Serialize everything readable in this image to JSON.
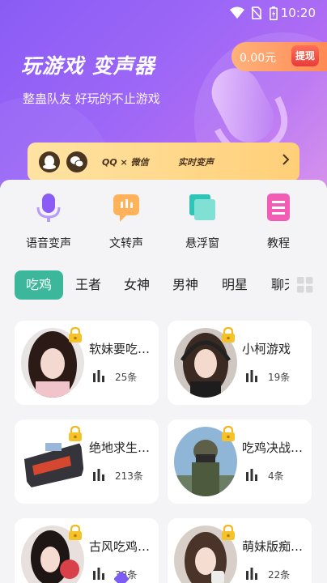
{
  "status_bar": {
    "time": "10:20"
  },
  "hero": {
    "title": "玩游戏  变声器",
    "subtitle": "整蛊队友 好玩的不止游戏",
    "balance": "0.00元",
    "withdraw_label": "提现"
  },
  "banner": {
    "left_text": "QQ × 微信",
    "right_text": "实时变声"
  },
  "menu": [
    {
      "label": "语音变声",
      "icon": "microphone-icon",
      "color": "#8b5cf6"
    },
    {
      "label": "文转声",
      "icon": "chat-bubble-icon",
      "color": "#ff9d3d"
    },
    {
      "label": "悬浮窗",
      "icon": "window-stack-icon",
      "color": "#2ec4b6"
    },
    {
      "label": "教程",
      "icon": "document-icon",
      "color": "#f25cb5"
    }
  ],
  "tabs": [
    "吃鸡",
    "王者",
    "女神",
    "男神",
    "明星",
    "聊天"
  ],
  "active_tab": "吃鸡",
  "cards": [
    {
      "name": "软妹要吃…",
      "count": "25条"
    },
    {
      "name": "小柯游戏",
      "count": "19条"
    },
    {
      "name": "绝地求生…",
      "count": "213条"
    },
    {
      "name": "吃鸡决战…",
      "count": "4条"
    },
    {
      "name": "古风吃鸡…",
      "count": "38条"
    },
    {
      "name": "萌妹版痴…",
      "count": "22条"
    }
  ],
  "colors": {
    "accent": "#3cb79b",
    "hero_start": "#8a5cf5",
    "hero_end": "#d285ea"
  }
}
